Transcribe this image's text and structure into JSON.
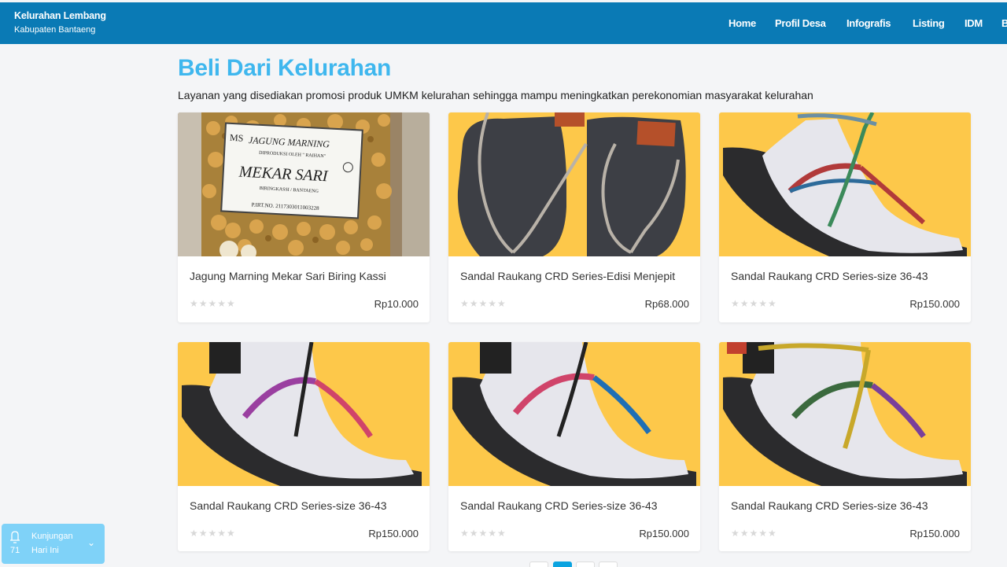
{
  "brand": {
    "name": "Kelurahan Lembang",
    "subtitle": "Kabupaten Bantaeng"
  },
  "nav": [
    {
      "label": "Home"
    },
    {
      "label": "Profil Desa"
    },
    {
      "label": "Infografis"
    },
    {
      "label": "Listing"
    },
    {
      "label": "IDM"
    },
    {
      "label": "B"
    }
  ],
  "section": {
    "title": "Beli Dari Kelurahan",
    "description": "Layanan yang disediakan promosi produk UMKM kelurahan sehingga mampu meningkatkan perekonomian masyarakat kelurahan"
  },
  "products": [
    {
      "title": "Jagung Marning Mekar Sari Biring Kassi",
      "price": "Rp10.000",
      "rating": "★★★★★",
      "image": "snack-bag"
    },
    {
      "title": "Sandal Raukang CRD Series-Edisi Menjepit",
      "price": "Rp68.000",
      "rating": "★★★★★",
      "image": "flip-flops"
    },
    {
      "title": "Sandal Raukang CRD Series-size 36-43",
      "price": "Rp150.000",
      "rating": "★★★★★",
      "image": "sandal"
    },
    {
      "title": "Sandal Raukang CRD Series-size 36-43",
      "price": "Rp150.000",
      "rating": "★★★★★",
      "image": "sandal"
    },
    {
      "title": "Sandal Raukang CRD Series-size 36-43",
      "price": "Rp150.000",
      "rating": "★★★★★",
      "image": "sandal"
    },
    {
      "title": "Sandal Raukang CRD Series-size 36-43",
      "price": "Rp150.000",
      "rating": "★★★★★",
      "image": "sandal"
    }
  ],
  "visitor": {
    "count": "71",
    "label": "Kunjungan",
    "period": "Hari Ini",
    "icon": "bell-icon"
  },
  "label_texts": {
    "jagung": "JAGUNG MARNING",
    "produksi": "DIPRODUKSI OLEH \" RAIHAN\"",
    "mekar": "MEKAR SARI",
    "lokasi": "BIRINGKASSI / BANTAENG",
    "pirt": "P.IRT.NO. 2117303011003228",
    "ms": "MS"
  },
  "colors": {
    "navbar": "#0a7ab5",
    "title": "#3fb7ee",
    "sandal_bg": "#fdc84a",
    "visitor_bg": "#7fd2f8",
    "pagination_active": "#0aa3e0"
  }
}
